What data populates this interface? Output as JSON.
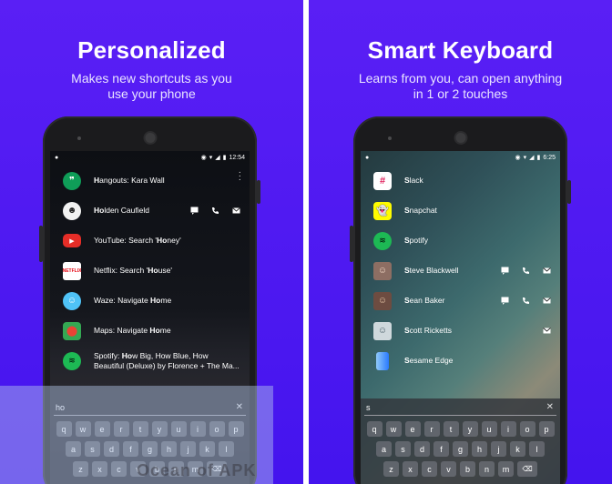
{
  "left": {
    "title": "Personalized",
    "subtitle_line1": "Makes new shortcuts as you",
    "subtitle_line2": "use your phone",
    "time": "12:54",
    "rows": [
      {
        "bold": "H",
        "rest": "angouts: Kara Wall",
        "icon_color": "#0f9d58",
        "icon": "hangouts-icon"
      },
      {
        "bold": "Ho",
        "rest": "lden Caufield",
        "icon_color": "#f2f2f2",
        "icon": "avatar-icon"
      },
      {
        "pre": "YouTube: Search '",
        "bold": "Ho",
        "rest": "ney'",
        "icon_color": "#e52d27",
        "icon": "youtube-icon"
      },
      {
        "pre": "Netflix: Search '",
        "bold": "Ho",
        "rest": "use'",
        "icon_color": "#ffffff",
        "icon": "netflix-icon"
      },
      {
        "pre": "Waze: Navigate ",
        "bold": "Ho",
        "rest": "me",
        "icon_color": "#4fc3f7",
        "icon": "waze-icon"
      },
      {
        "pre": "Maps: Navigate ",
        "bold": "Ho",
        "rest": "me",
        "icon_color": "#34a853",
        "icon": "maps-icon"
      },
      {
        "pre": "Spotify: ",
        "bold": "Ho",
        "rest": "w Big, How Blue, How Beautiful (Deluxe) by Florence + The Ma...",
        "icon_color": "#1db954",
        "icon": "spotify-icon"
      }
    ],
    "query": "ho",
    "keys_row1": [
      "q",
      "w",
      "e",
      "r",
      "t",
      "y",
      "u",
      "i",
      "o",
      "p"
    ],
    "keys_row2": [
      "a",
      "s",
      "d",
      "f",
      "g",
      "h",
      "j",
      "k",
      "l"
    ],
    "keys_row3": [
      "z",
      "x",
      "c",
      "v",
      "b",
      "n",
      "m"
    ],
    "watermark": "Ocean of APK"
  },
  "right": {
    "title": "Smart Keyboard",
    "subtitle_line1": "Learns from you, can open anything",
    "subtitle_line2": "in 1 or 2 touches",
    "time": "6:25",
    "rows": [
      {
        "bold": "S",
        "rest": "lack",
        "icon_color": "#ffffff",
        "icon": "slack-icon"
      },
      {
        "bold": "S",
        "rest": "napchat",
        "icon_color": "#fffc00",
        "icon": "snapchat-icon"
      },
      {
        "bold": "S",
        "rest": "potify",
        "icon_color": "#1db954",
        "icon": "spotify-icon"
      },
      {
        "bold": "S",
        "rest": "teve Blackwell",
        "icon_color": "#8d6e63",
        "icon": "contact-photo-icon"
      },
      {
        "bold": "S",
        "rest": "ean Baker",
        "icon_color": "#6d4c41",
        "icon": "contact-photo-icon"
      },
      {
        "bold": "S",
        "rest": "cott Ricketts",
        "icon_color": "#cfd8dc",
        "icon": "contact-photo-icon"
      },
      {
        "bold": "S",
        "rest": "esame Edge",
        "icon_color": "#2979ff",
        "icon": "sesame-icon"
      }
    ],
    "query": "s",
    "keys_row1": [
      "q",
      "w",
      "e",
      "r",
      "t",
      "y",
      "u",
      "i",
      "o",
      "p"
    ],
    "keys_row2": [
      "a",
      "s",
      "d",
      "f",
      "g",
      "h",
      "j",
      "k",
      "l"
    ],
    "keys_row3": [
      "z",
      "x",
      "c",
      "v",
      "b",
      "n",
      "m"
    ]
  }
}
